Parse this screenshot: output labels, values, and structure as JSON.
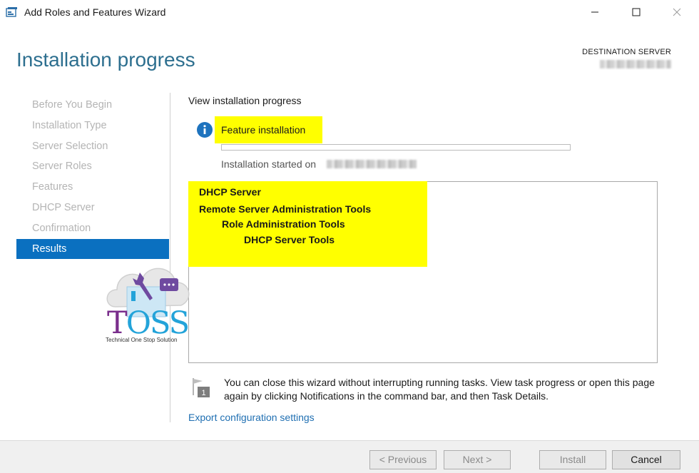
{
  "window": {
    "title": "Add Roles and Features Wizard",
    "minimize_glyph": "—",
    "maximize_glyph": "☐",
    "close_glyph": "✕"
  },
  "header": {
    "page_title": "Installation progress",
    "destination_label": "DESTINATION SERVER",
    "destination_value": ""
  },
  "nav": {
    "items": [
      {
        "label": "Before You Begin",
        "active": false
      },
      {
        "label": "Installation Type",
        "active": false
      },
      {
        "label": "Server Selection",
        "active": false
      },
      {
        "label": "Server Roles",
        "active": false
      },
      {
        "label": "Features",
        "active": false
      },
      {
        "label": "DHCP Server",
        "active": false
      },
      {
        "label": "Confirmation",
        "active": false
      },
      {
        "label": "Results",
        "active": true
      }
    ]
  },
  "content": {
    "section_label": "View installation progress",
    "status_title": "Feature installation",
    "progress_fraction": 0,
    "started_label": "Installation started on",
    "started_value": "",
    "results": [
      "DHCP Server",
      "Remote Server Administration Tools",
      "Role Administration Tools",
      "DHCP Server Tools"
    ],
    "notice": "You can close this wizard without interrupting running tasks. View task progress or open this page again by clicking Notifications in the command bar, and then Task Details.",
    "notice_badge": "1",
    "export_link": "Export configuration settings"
  },
  "watermark": {
    "logo_letter_t": "T",
    "logo_letters_oss": "OSS",
    "logo_subtitle": "Technical One Stop Solution"
  },
  "footer": {
    "previous": "< Previous",
    "next": "Next >",
    "install": "Install",
    "cancel": "Cancel"
  },
  "colors": {
    "accent": "#0a70c0",
    "title": "#2d6f8f",
    "highlight": "#ffff00",
    "link": "#1f6fb2"
  }
}
